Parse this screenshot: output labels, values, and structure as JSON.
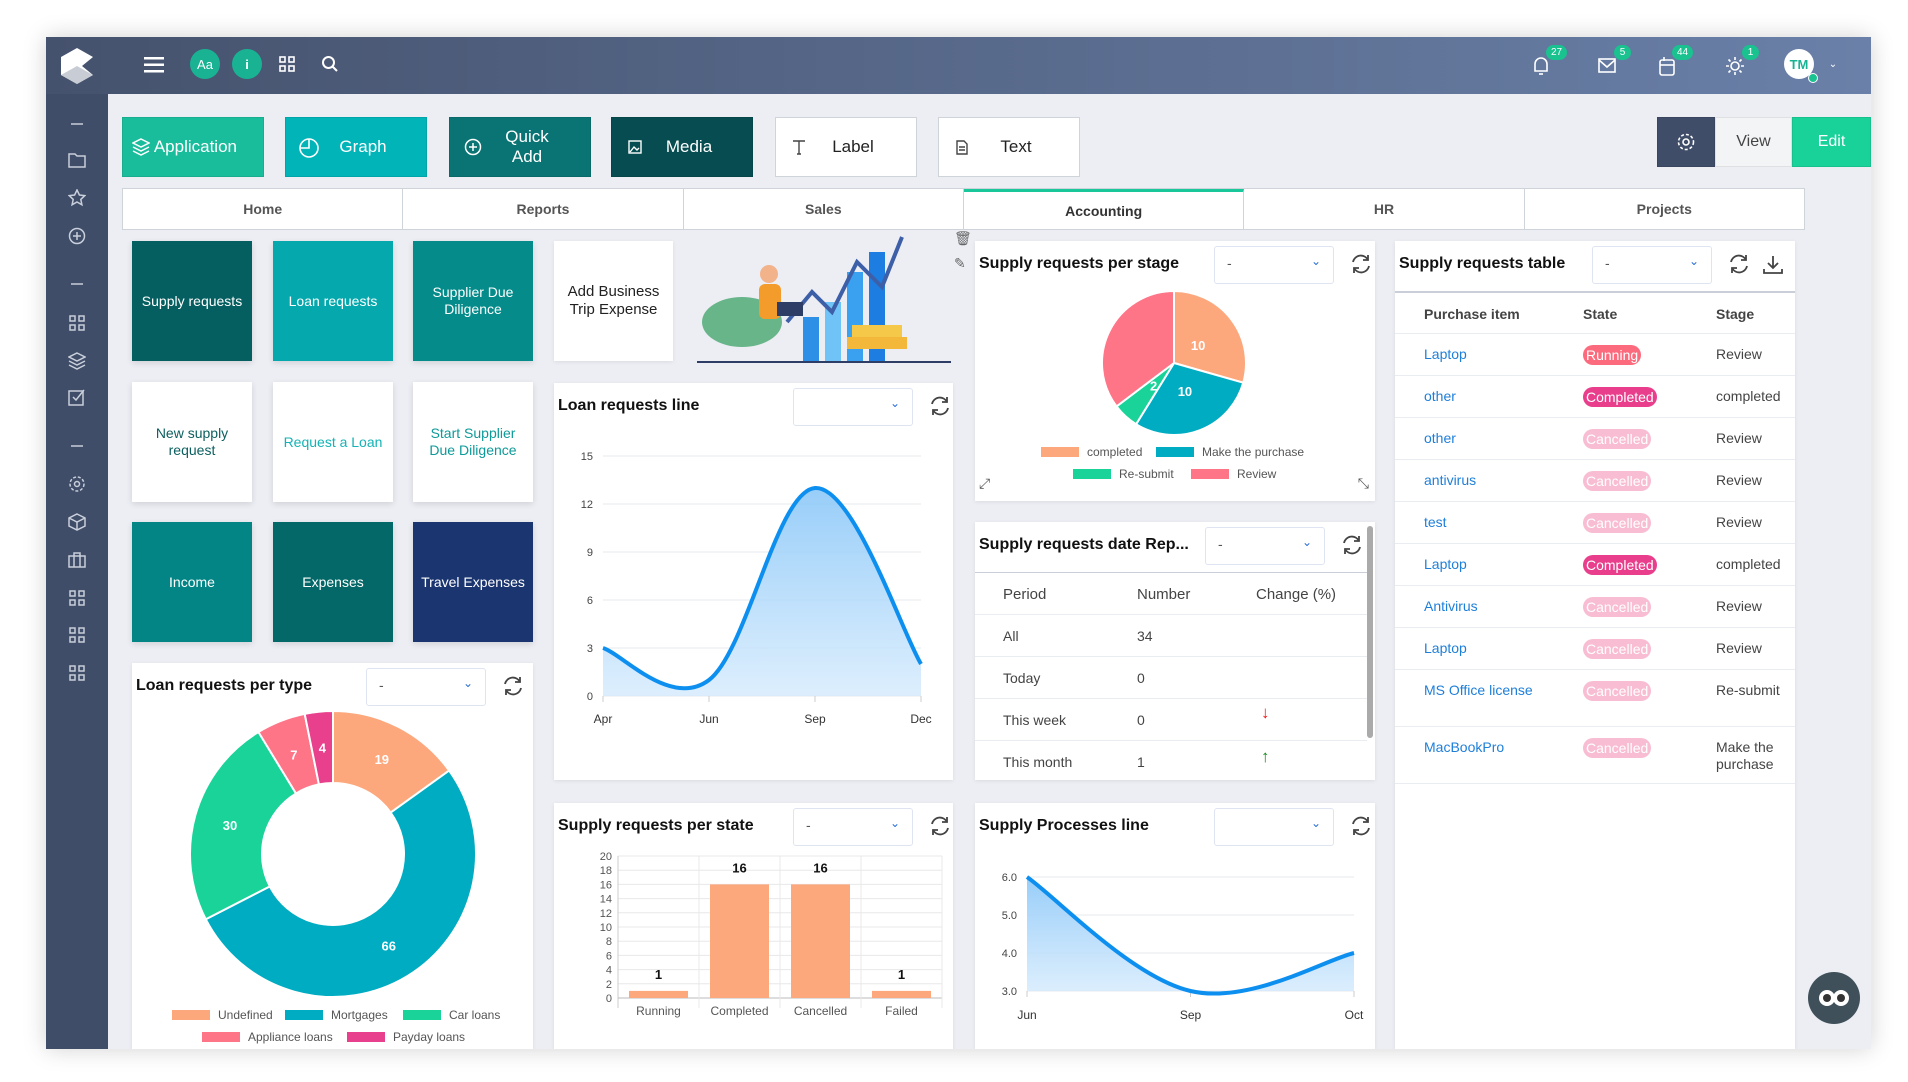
{
  "topbar": {
    "left_icons": [
      "logo-icon",
      "menu-icon",
      "font-icon",
      "info-icon",
      "qr-code-icon",
      "search-icon"
    ],
    "font_badge": "Aa",
    "info_badge": "i",
    "notifications": {
      "bell": "27",
      "mail": "5",
      "calendar": "44",
      "sun": "1"
    },
    "avatar": "TM"
  },
  "sidebar": {
    "icons": [
      "collapse-icon",
      "folder-icon",
      "star-icon",
      "plus-circle-icon",
      "collapse-icon",
      "grid-icon",
      "layers-icon",
      "checkbox-icon",
      "collapse-icon",
      "gear-icon",
      "box-icon",
      "briefcase-icon",
      "grid-icon",
      "grid-icon",
      "grid-icon"
    ]
  },
  "toolbar": {
    "buttons": [
      {
        "label": "Application",
        "icon": "layers-icon",
        "color": "#19bc9b"
      },
      {
        "label": "Graph",
        "icon": "pie-chart-icon",
        "color": "#00b4b8"
      },
      {
        "label": "Quick Add",
        "icon": "plus-circle-icon",
        "color": "#0a7373"
      },
      {
        "label": "Media",
        "icon": "image-icon",
        "color": "#064c50"
      },
      {
        "label": "Label",
        "icon": "text-t-icon",
        "color": "#ffffff"
      },
      {
        "label": "Text",
        "icon": "document-icon",
        "color": "#ffffff"
      }
    ],
    "view": "View",
    "edit": "Edit"
  },
  "tabs": [
    {
      "label": "Home"
    },
    {
      "label": "Reports"
    },
    {
      "label": "Sales"
    },
    {
      "label": "Accounting",
      "active": true
    },
    {
      "label": "HR"
    },
    {
      "label": "Projects"
    }
  ],
  "tiles": [
    {
      "label": "Supply requests",
      "bg": "#055f60",
      "fg": "#ffffff"
    },
    {
      "label": "Loan requests",
      "bg": "#05a9ad",
      "fg": "#ffffff"
    },
    {
      "label": "Supplier Due Diligence",
      "bg": "#048b8a",
      "fg": "#ffffff"
    },
    {
      "label": "New supply request",
      "bg": "#ffffff",
      "fg": "#0c5f60"
    },
    {
      "label": "Request a Loan",
      "bg": "#ffffff",
      "fg": "#14b3b6"
    },
    {
      "label": "Start Supplier Due Diligence",
      "bg": "#ffffff",
      "fg": "#0d9a98"
    },
    {
      "label": "Income",
      "bg": "#038585",
      "fg": "#ffffff"
    },
    {
      "label": "Expenses",
      "bg": "#036867",
      "fg": "#ffffff"
    },
    {
      "label": "Travel Expenses",
      "bg": "#1b3570",
      "fg": "#ffffff"
    }
  ],
  "trip_card": {
    "label": "Add Business Trip Expense"
  },
  "loan_line": {
    "title": "Loan requests line",
    "dropdown": ""
  },
  "loan_type": {
    "title": "Loan requests per type",
    "dropdown": "-"
  },
  "supply_state": {
    "title": "Supply requests per state",
    "dropdown": "-"
  },
  "supply_stage": {
    "title": "Supply requests per stage",
    "dropdown": "-"
  },
  "date_report": {
    "title": "Supply requests date Rep...",
    "dropdown": "-",
    "columns": [
      "Period",
      "Number",
      "Change (%)"
    ],
    "rows": [
      {
        "period": "All",
        "number": "34",
        "change": ""
      },
      {
        "period": "Today",
        "number": "0",
        "change": ""
      },
      {
        "period": "This week",
        "number": "0",
        "change": "down"
      },
      {
        "period": "This month",
        "number": "1",
        "change": "up"
      }
    ],
    "colors": {
      "down": "#f01818",
      "up": "#138a1c"
    }
  },
  "processes": {
    "title": "Supply Processes line",
    "dropdown": ""
  },
  "supply_table": {
    "title": "Supply requests table",
    "dropdown": "-",
    "columns": [
      "Purchase item",
      "State",
      "Stage"
    ],
    "rows": [
      {
        "item": "Laptop",
        "state": "Running",
        "stage": "Review"
      },
      {
        "item": "other",
        "state": "Completed",
        "stage": "completed"
      },
      {
        "item": "other",
        "state": "Cancelled",
        "stage": "Review"
      },
      {
        "item": "antivirus",
        "state": "Cancelled",
        "stage": "Review"
      },
      {
        "item": "test",
        "state": "Cancelled",
        "stage": "Review"
      },
      {
        "item": "Laptop",
        "state": "Completed",
        "stage": "completed"
      },
      {
        "item": "Antivirus",
        "state": "Cancelled",
        "stage": "Review"
      },
      {
        "item": "Laptop",
        "state": "Cancelled",
        "stage": "Review"
      },
      {
        "item": "MS Office license",
        "state": "Cancelled",
        "stage": "Re-submit"
      },
      {
        "item": "MacBookPro",
        "state": "Cancelled",
        "stage": "Make the purchase"
      }
    ],
    "state_colors": {
      "Running": "#fb6b7d",
      "Completed": "#e83e8c",
      "Cancelled": "#f8bdd2"
    }
  },
  "chart_data": [
    {
      "type": "area",
      "x": [
        "Apr",
        "Jun",
        "Sep",
        "Dec"
      ],
      "values": [
        3,
        1,
        13,
        2
      ],
      "ylim": [
        0,
        15
      ],
      "yticks": [
        "0",
        "3",
        "6",
        "9",
        "12",
        "15"
      ],
      "color": "#0d8ff0",
      "grid": true
    },
    {
      "type": "pie",
      "donut": true,
      "categories": [
        "Undefined",
        "Mortgages",
        "Car loans",
        "Appliance loans",
        "Payday loans"
      ],
      "values": [
        19,
        66,
        30,
        7,
        4
      ],
      "colors": [
        "#fda77d",
        "#00acc1",
        "#19d399",
        "#fe7588",
        "#e8408c"
      ],
      "legend": "bottom"
    },
    {
      "type": "bar",
      "categories": [
        "Running",
        "Completed",
        "Cancelled",
        "Failed"
      ],
      "values": [
        1,
        16,
        16,
        1
      ],
      "ylim": [
        0,
        20
      ],
      "yticks": [
        "0",
        "2",
        "4",
        "6",
        "8",
        "10",
        "12",
        "14",
        "16",
        "18",
        "20"
      ],
      "color": "#fda77d",
      "grid": true
    },
    {
      "type": "pie",
      "categories": [
        "completed",
        "Make the purchase",
        "Re-submit",
        "Review"
      ],
      "values": [
        10,
        10,
        2,
        12
      ],
      "colors": [
        "#fda77d",
        "#00acc1",
        "#19d399",
        "#fe7588"
      ],
      "labels": [
        "10",
        "10",
        "2",
        ""
      ],
      "legend": "bottom"
    },
    {
      "type": "area",
      "x": [
        "Jun",
        "Sep",
        "Oct"
      ],
      "values": [
        6,
        3,
        4
      ],
      "ylim": [
        3,
        6
      ],
      "yticks": [
        "3.0",
        "4.0",
        "5.0",
        "6.0"
      ],
      "color": "#0d8ff0",
      "grid": true
    }
  ]
}
